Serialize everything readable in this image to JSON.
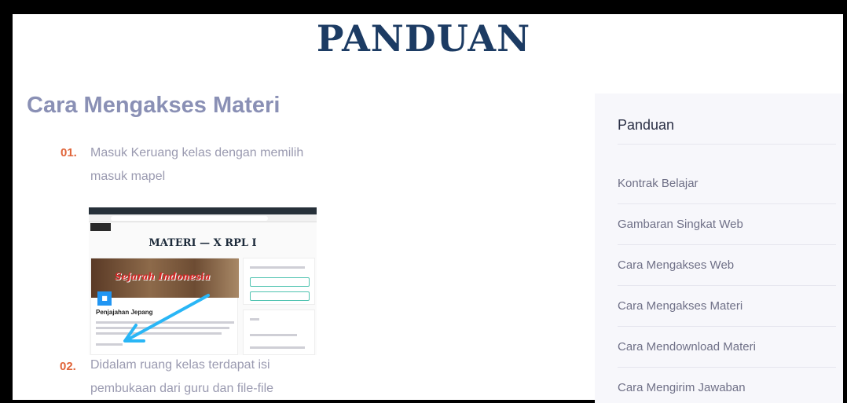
{
  "page": {
    "title": "PANDUAN",
    "section_heading": "Cara Mengakses Materi"
  },
  "steps": [
    {
      "number": "01.",
      "text": "Masuk Keruang kelas dengan memilih masuk mapel"
    },
    {
      "number": "02.",
      "text": "Didalam ruang kelas terdapat isi pembukaan dari guru dan file-file"
    }
  ],
  "screenshot": {
    "title": "MATERI — X RPL I",
    "banner_text": "Sejarah Indonesia",
    "card_title": "Penjajahan Jepang"
  },
  "sidebar": {
    "title": "Panduan",
    "items": [
      {
        "label": "Kontrak Belajar"
      },
      {
        "label": "Gambaran Singkat Web"
      },
      {
        "label": "Cara Mengakses Web"
      },
      {
        "label": "Cara Mengakses Materi"
      },
      {
        "label": "Cara Mendownload Materi"
      },
      {
        "label": "Cara Mengirim Jawaban"
      }
    ]
  },
  "colors": {
    "title": "#1c3b63",
    "heading": "#8a90b5",
    "step_number": "#e0653a",
    "step_text": "#9a9ab0",
    "sidebar_bg": "#f7f7fb",
    "arrow": "#29b6f6"
  }
}
